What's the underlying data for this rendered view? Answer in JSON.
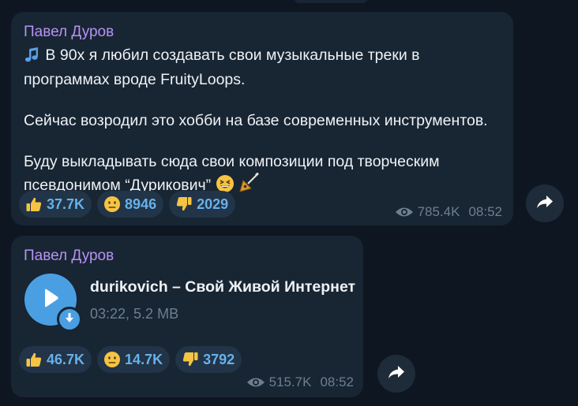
{
  "messages": [
    {
      "sender": "Павел Дуров",
      "emoji_music": "🎵",
      "paragraphs": [
        "В 90х я любил создавать свои музыкальные треки в программах вроде FruityLoops.",
        "Сейчас возродил это хобби на базе современных инструментов.",
        "Буду выкладывать сюда свои композиции под творческим псевдонимом “Дурикович”"
      ],
      "trailing_emojis": [
        "grinning-squinting-face",
        "balalaika"
      ],
      "reactions": [
        {
          "emoji": "thumbs-up",
          "count": "37.7K"
        },
        {
          "emoji": "neutral-face",
          "count": "8946"
        },
        {
          "emoji": "thumbs-down",
          "count": "2029"
        }
      ],
      "views": "785.4K",
      "time": "08:52"
    },
    {
      "sender": "Павел Дуров",
      "audio": {
        "title": "durikovich – Свой Живой Интернет",
        "info": "03:22, 5.2 MB"
      },
      "reactions": [
        {
          "emoji": "thumbs-up",
          "count": "46.7K"
        },
        {
          "emoji": "neutral-face",
          "count": "14.7K"
        },
        {
          "emoji": "thumbs-down",
          "count": "3792"
        }
      ],
      "views": "515.7K",
      "time": "08:52"
    }
  ],
  "colors": {
    "background": "#0e1621",
    "bubble": "#182533",
    "sender": "#b792f4",
    "reaction_bg": "#223447",
    "reaction_count": "#66b1ea",
    "meta": "#6d7f8f",
    "accent": "#4a9fe2"
  }
}
